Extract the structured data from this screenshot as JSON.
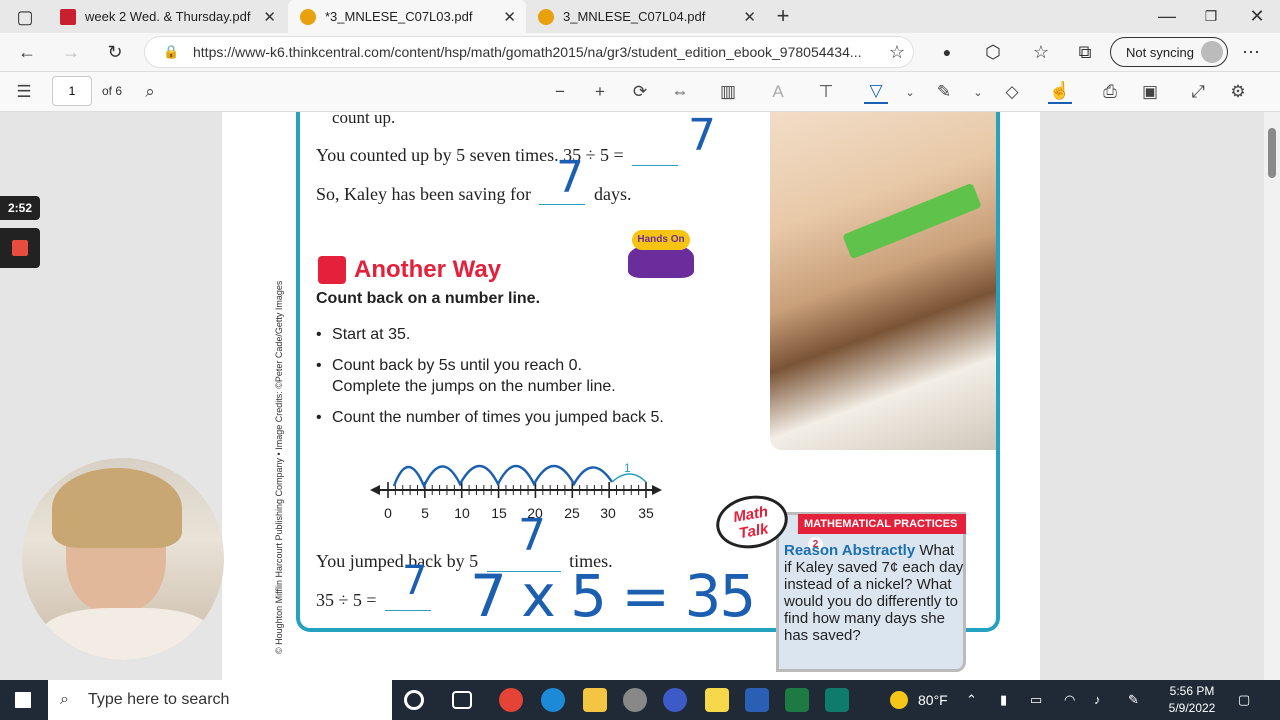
{
  "tabs": [
    {
      "label": "week 2 Wed. & Thursday.pdf",
      "icon": "pdf-icon",
      "active": false
    },
    {
      "label": "*3_MNLESE_C07L03.pdf",
      "icon": "circle-icon",
      "active": true
    },
    {
      "label": "3_MNLESE_C07L04.pdf",
      "icon": "circle-icon",
      "active": false
    }
  ],
  "address": {
    "url": "https://www-k6.thinkcentral.com/content/hsp/math/gomath2015/na/gr3/student_edition_ebook_978054434...",
    "sync_label": "Not syncing"
  },
  "pdf_toolbar": {
    "page": "1",
    "of_pages": "of 6"
  },
  "recorder": {
    "time": "2:52"
  },
  "worksheet": {
    "line_count_up": "count up.",
    "line1_prefix": "You counted up by 5 seven times. 35 ÷ 5 =",
    "line2_prefix": "So, Kaley has been saving for",
    "line2_suffix": "days.",
    "heading": "Another Way",
    "subheading": "Count back on a number line.",
    "bullets": [
      "Start at 35.",
      "Count back by 5s until you reach 0.",
      "Complete the jumps on the number line.",
      "Count the number of times you jumped back 5."
    ],
    "number_line_labels": [
      "0",
      "5",
      "10",
      "15",
      "20",
      "25",
      "30",
      "35"
    ],
    "jump_label": "1",
    "jumped_prefix": "You jumped back by 5",
    "jumped_suffix": "times.",
    "division": "35 ÷ 5 =",
    "handwritten_answers": [
      "7",
      "7",
      "7",
      "7"
    ],
    "handwritten_equation": "7 x 5 = 35",
    "hands_on": "Hands On",
    "credit": "© Houghton Mifflin Harcourt Publishing Company • Image Credits: ©Peter Cade/Getty Images"
  },
  "math_talk": {
    "badge": "Math Talk",
    "practices": "MATHEMATICAL PRACTICES",
    "practices_num": "2",
    "title": "Reason Abstractly",
    "body": "What if Kaley saved 7¢ each day instead of a nickel? What would you do differently to find how many days she has saved?"
  },
  "taskbar": {
    "search_placeholder": "Type here to search",
    "weather": "80°F",
    "time": "5:56 PM",
    "date": "5/9/2022"
  },
  "colors": {
    "accent": "#25a2bf",
    "heading_red": "#e4203a",
    "handwriting": "#1c5fb0"
  }
}
